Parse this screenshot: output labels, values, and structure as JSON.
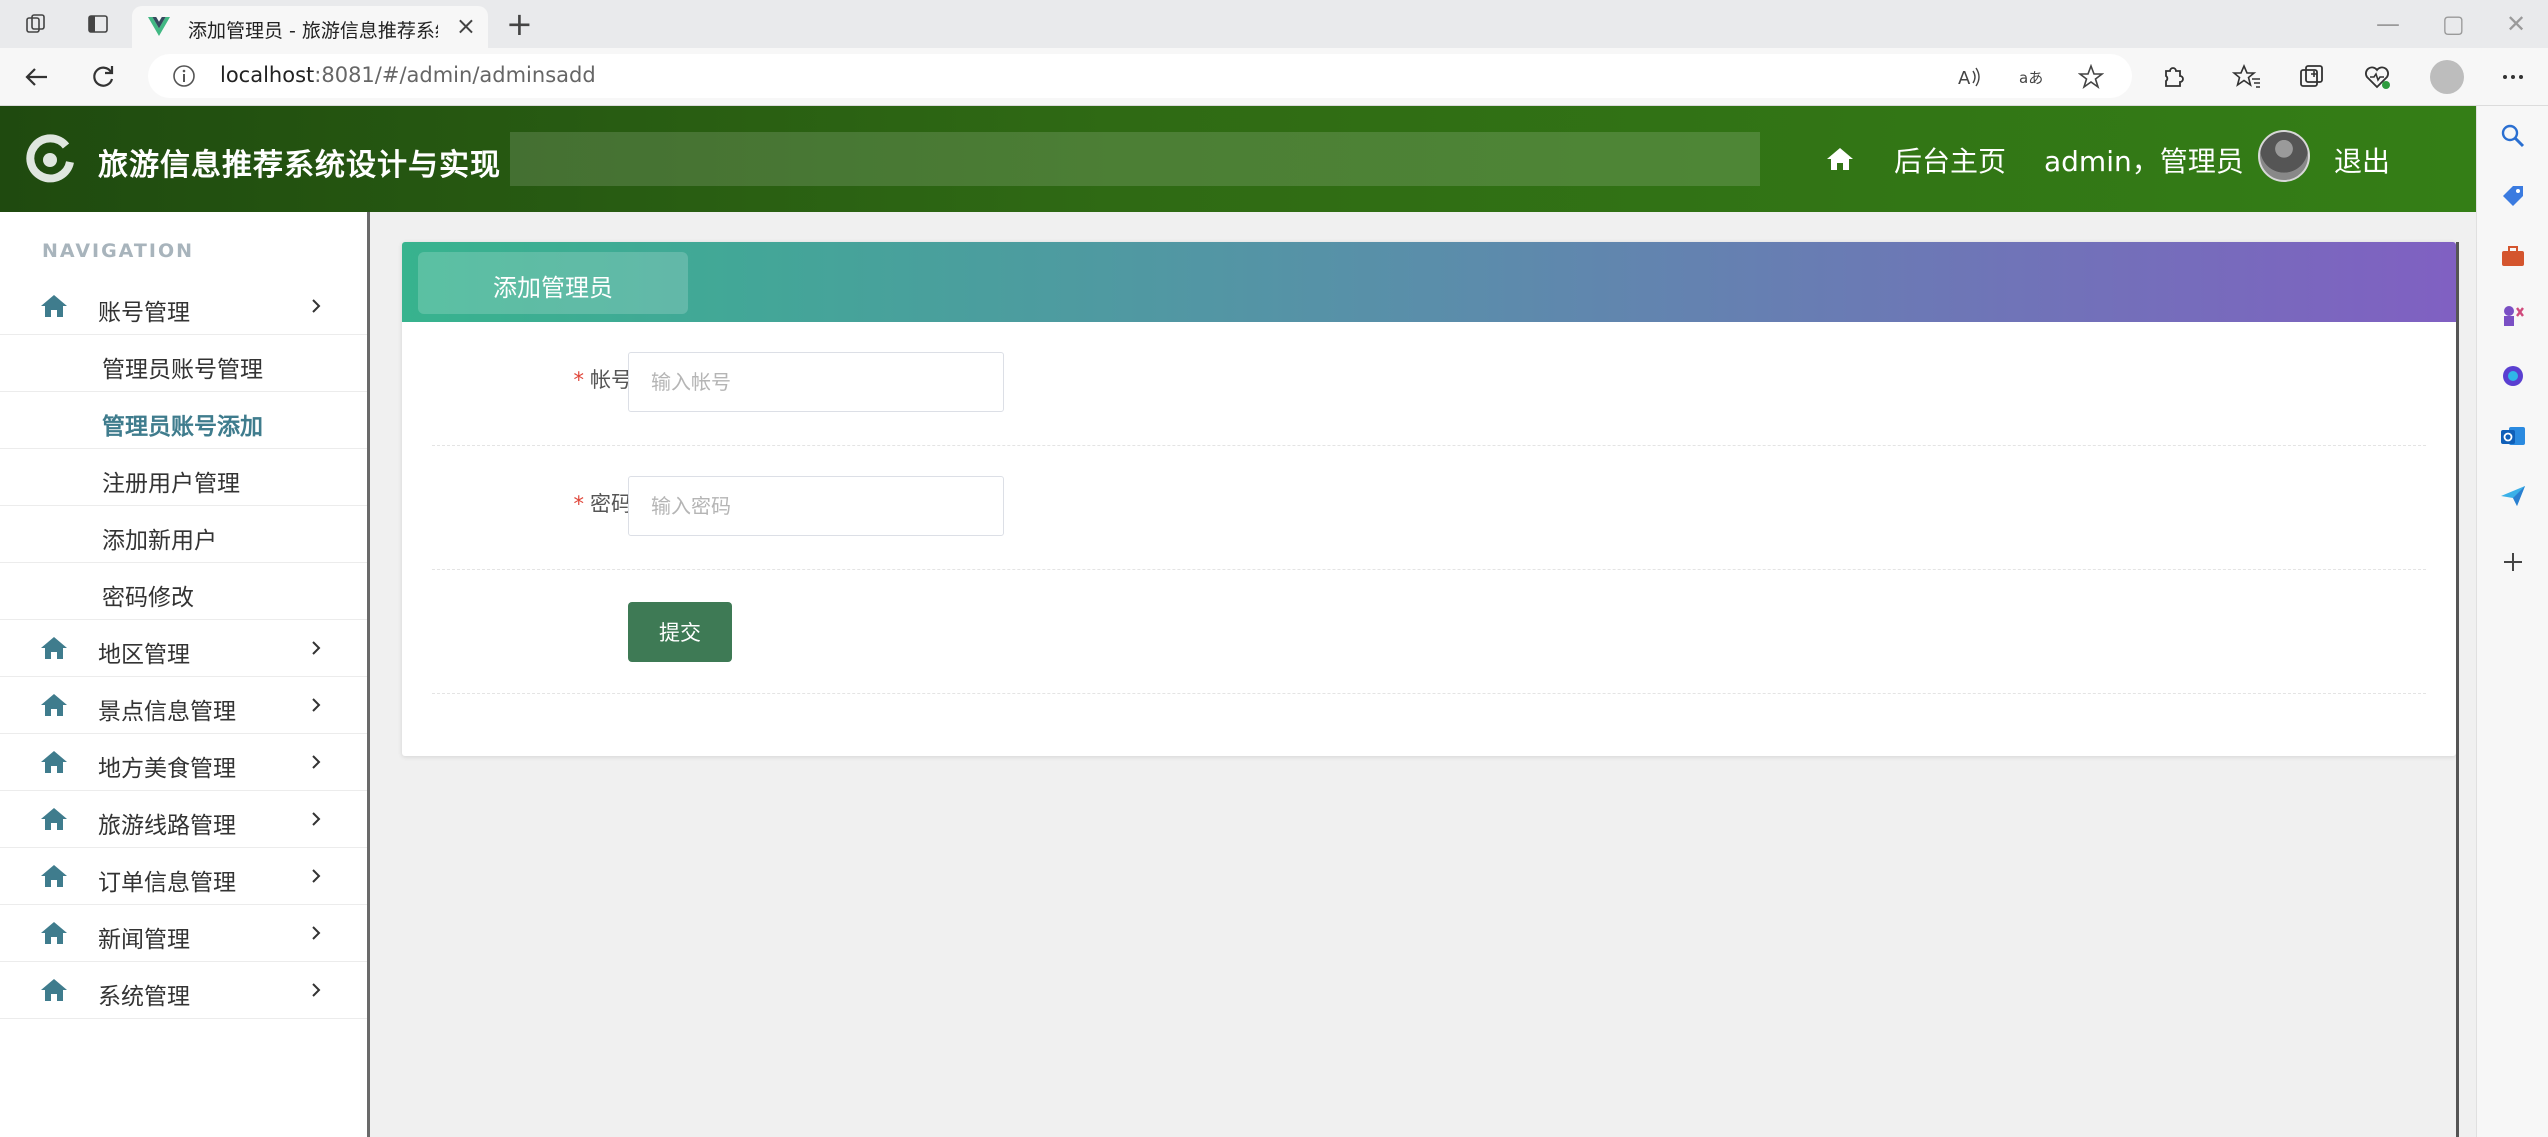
{
  "browser": {
    "tab_title": "添加管理员 - 旅游信息推荐系统设计与实现",
    "tab_close": "×",
    "new_tab": "+",
    "url_host": "localhost",
    "url_rest": ":8081/#/admin/adminsadd",
    "controls": {
      "minimize": "—",
      "maximize": "▢",
      "close": "✕"
    }
  },
  "header": {
    "title": "旅游信息推荐系统设计与实现",
    "home_link": "后台主页",
    "user_label": "admin，管理员",
    "logout": "退出",
    "bg_color": "#2f6a14"
  },
  "sidebar": {
    "caption": "NAVIGATION",
    "groups": [
      {
        "label": "账号管理",
        "expanded": true
      },
      {
        "label": "地区管理"
      },
      {
        "label": "景点信息管理"
      },
      {
        "label": "地方美食管理"
      },
      {
        "label": "旅游线路管理"
      },
      {
        "label": "订单信息管理"
      },
      {
        "label": "新闻管理"
      },
      {
        "label": "系统管理"
      }
    ],
    "account_items": [
      {
        "label": "管理员账号管理"
      },
      {
        "label": "管理员账号添加",
        "active": true
      },
      {
        "label": "注册用户管理"
      },
      {
        "label": "添加新用户"
      },
      {
        "label": "密码修改"
      }
    ],
    "icon_color": "#3f7c8d"
  },
  "card": {
    "tab_label": "添加管理员",
    "fields": [
      {
        "label": "帐号",
        "required_mark": "*",
        "placeholder": "输入帐号",
        "value": ""
      },
      {
        "label": "密码",
        "required_mark": "*",
        "placeholder": "输入密码",
        "value": ""
      }
    ],
    "submit_label": "提交",
    "submit_color": "#3e7a55"
  }
}
